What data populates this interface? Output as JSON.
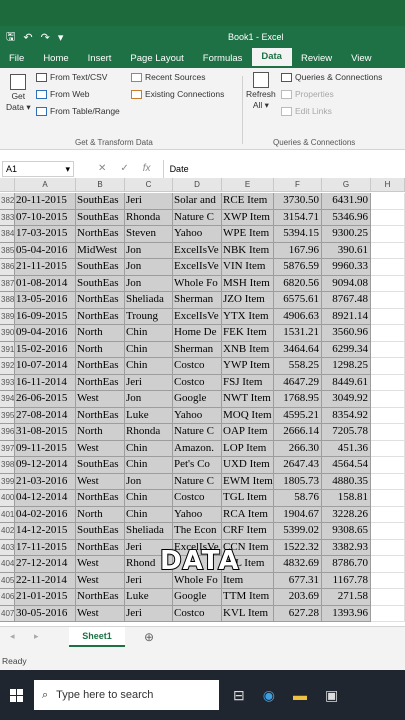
{
  "titlebar": {
    "title": "Book1 - Excel",
    "qa_icons": [
      "save-icon",
      "undo-icon",
      "redo-icon",
      "customize-icon"
    ]
  },
  "menu": {
    "tabs": [
      "File",
      "Home",
      "Insert",
      "Page Layout",
      "Formulas",
      "Data",
      "Review",
      "View"
    ],
    "active": "Data"
  },
  "ribbon": {
    "get_data": {
      "line1": "Get",
      "line2": "Data ▾"
    },
    "from_text_csv": "From Text/CSV",
    "from_web": "From Web",
    "from_table_range": "From Table/Range",
    "recent_sources": "Recent Sources",
    "existing_connections": "Existing Connections",
    "group1_label": "Get & Transform Data",
    "refresh": {
      "line1": "Refresh",
      "line2": "All ▾"
    },
    "queries_connections": "Queries & Connections",
    "properties": "Properties",
    "edit_links": "Edit Links",
    "group2_label": "Queries & Connections"
  },
  "formula_bar": {
    "name_box": "A1",
    "fx": "fx",
    "value": "Date"
  },
  "grid": {
    "columns": [
      "A",
      "B",
      "C",
      "D",
      "E",
      "F",
      "G",
      "H"
    ],
    "rows": [
      [
        "382",
        "20-11-2015",
        "SouthEas",
        "Jeri",
        "Solar and",
        "RCE Item",
        "3730.50",
        "6431.90"
      ],
      [
        "383",
        "07-10-2015",
        "SouthEas",
        "Rhonda",
        "Nature C",
        "XWP Item",
        "3154.71",
        "5346.96"
      ],
      [
        "384",
        "17-03-2015",
        "NorthEas",
        "Steven",
        "Yahoo",
        "WPE Item",
        "5394.15",
        "9300.25"
      ],
      [
        "385",
        "05-04-2016",
        "MidWest",
        "Jon",
        "ExcelIsVe",
        "NBK Item",
        "167.96",
        "390.61"
      ],
      [
        "386",
        "21-11-2015",
        "SouthEas",
        "Jon",
        "ExcelIsVe",
        "VIN Item",
        "5876.59",
        "9960.33"
      ],
      [
        "387",
        "01-08-2014",
        "SouthEas",
        "Jon",
        "Whole Fo",
        "MSH Item",
        "6820.56",
        "9094.08"
      ],
      [
        "388",
        "13-05-2016",
        "NorthEas",
        "Sheliada",
        "Sherman",
        "JZO Item",
        "6575.61",
        "8767.48"
      ],
      [
        "389",
        "16-09-2015",
        "NorthEas",
        "Troung",
        "ExcelIsVe",
        "YTX Item",
        "4906.63",
        "8921.14"
      ],
      [
        "390",
        "09-04-2016",
        "North",
        "Chin",
        "Home De",
        "FEK Item",
        "1531.21",
        "3560.96"
      ],
      [
        "391",
        "15-02-2016",
        "North",
        "Chin",
        "Sherman",
        "XNB Item",
        "3464.64",
        "6299.34"
      ],
      [
        "392",
        "10-07-2014",
        "NorthEas",
        "Chin",
        "Costco",
        "YWP Item",
        "558.25",
        "1298.25"
      ],
      [
        "393",
        "16-11-2014",
        "NorthEas",
        "Jeri",
        "Costco",
        "FSJ Item",
        "4647.29",
        "8449.61"
      ],
      [
        "394",
        "26-06-2015",
        "West",
        "Jon",
        "Google",
        "NWT Item",
        "1768.95",
        "3049.92"
      ],
      [
        "395",
        "27-08-2014",
        "NorthEas",
        "Luke",
        "Yahoo",
        "MOQ Item",
        "4595.21",
        "8354.92"
      ],
      [
        "396",
        "31-08-2015",
        "North",
        "Rhonda",
        "Nature C",
        "OAP Item",
        "2666.14",
        "7205.78"
      ],
      [
        "397",
        "09-11-2015",
        "West",
        "Chin",
        "Amazon.",
        "LOP Item",
        "266.30",
        "451.36"
      ],
      [
        "398",
        "09-12-2014",
        "SouthEas",
        "Chin",
        "Pet's Co",
        "UXD Item",
        "2647.43",
        "4564.54"
      ],
      [
        "399",
        "21-03-2016",
        "West",
        "Jon",
        "Nature C",
        "EWM Item",
        "1805.73",
        "4880.35"
      ],
      [
        "400",
        "04-12-2014",
        "NorthEas",
        "Chin",
        "Costco",
        "TGL Item",
        "58.76",
        "158.81"
      ],
      [
        "401",
        "04-02-2016",
        "North",
        "Chin",
        "Yahoo",
        "RCA Item",
        "1904.67",
        "3228.26"
      ],
      [
        "402",
        "14-12-2015",
        "SouthEas",
        "Sheliada",
        "The Econ",
        "CRF Item",
        "5399.02",
        "9308.65"
      ],
      [
        "403",
        "17-11-2015",
        "NorthEas",
        "Jeri",
        "ExcelIsVe",
        "CCN Item",
        "1522.32",
        "3382.93"
      ],
      [
        "404",
        "27-12-2014",
        "West",
        "Rhond",
        "",
        "JKL Item",
        "4832.69",
        "8786.70"
      ],
      [
        "405",
        "22-11-2014",
        "West",
        "Jeri",
        "Whole Fo",
        "Item",
        "677.31",
        "1167.78"
      ],
      [
        "406",
        "21-01-2015",
        "NorthEas",
        "Luke",
        "Google",
        "TTM Item",
        "203.69",
        "271.58"
      ],
      [
        "407",
        "30-05-2016",
        "West",
        "Jeri",
        "Costco",
        "KVL Item",
        "627.28",
        "1393.96"
      ]
    ]
  },
  "overlay_text": "DATA",
  "sheet_tab": "Sheet1",
  "status": "Ready",
  "taskbar": {
    "search_placeholder": "Type here to search"
  }
}
